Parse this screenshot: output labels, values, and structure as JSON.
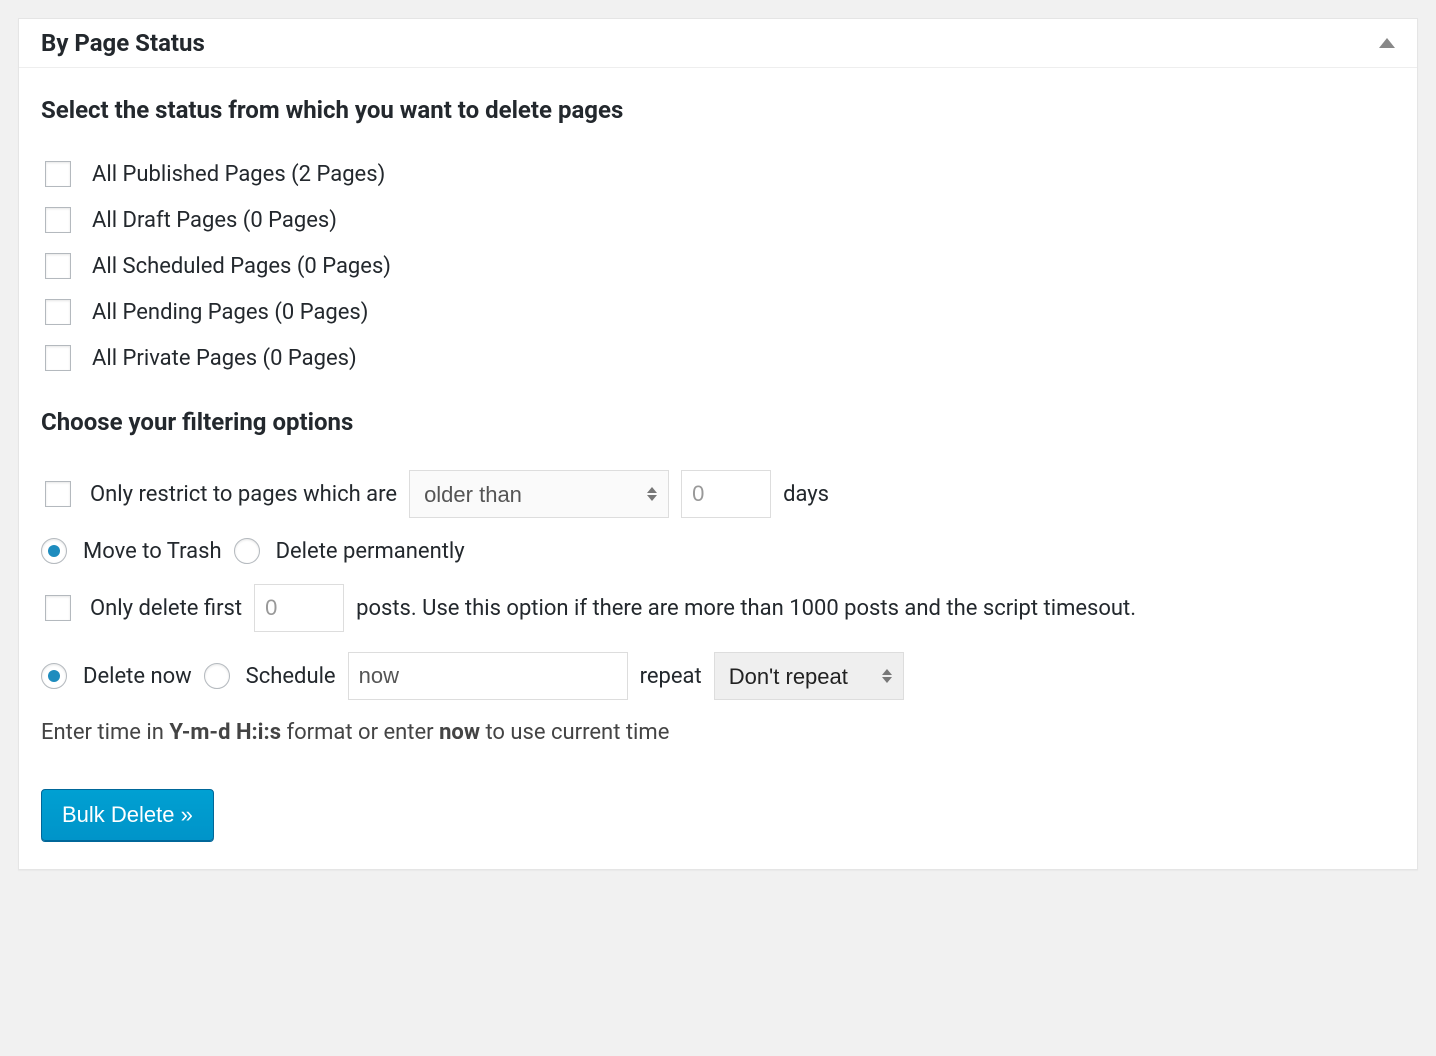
{
  "panel": {
    "title": "By Page Status"
  },
  "sections": {
    "status_title": "Select the status from which you want to delete pages",
    "filter_title": "Choose your filtering options"
  },
  "statuses": [
    "All Published Pages (2 Pages)",
    "All Draft Pages (0 Pages)",
    "All Scheduled Pages (0 Pages)",
    "All Pending Pages (0 Pages)",
    "All Private Pages (0 Pages)"
  ],
  "filters": {
    "restrict_label": "Only restrict to pages which are",
    "age_compare_selected": "older than",
    "age_value": "0",
    "days_label": "days",
    "move_trash_label": "Move to Trash",
    "delete_perm_label": "Delete permanently",
    "only_first_label": "Only delete first",
    "only_first_value": "0",
    "only_first_suffix": "posts. Use this option if there are more than 1000 posts and the script timesout.",
    "delete_now_label": "Delete now",
    "schedule_label": "Schedule",
    "schedule_value": "now",
    "repeat_label": "repeat",
    "repeat_selected": "Don't repeat",
    "time_hint_pre": "Enter time in ",
    "time_hint_fmt": "Y-m-d H:i:s",
    "time_hint_mid": " format or enter ",
    "time_hint_now": "now",
    "time_hint_post": " to use current time"
  },
  "button": {
    "submit": "Bulk Delete »"
  }
}
